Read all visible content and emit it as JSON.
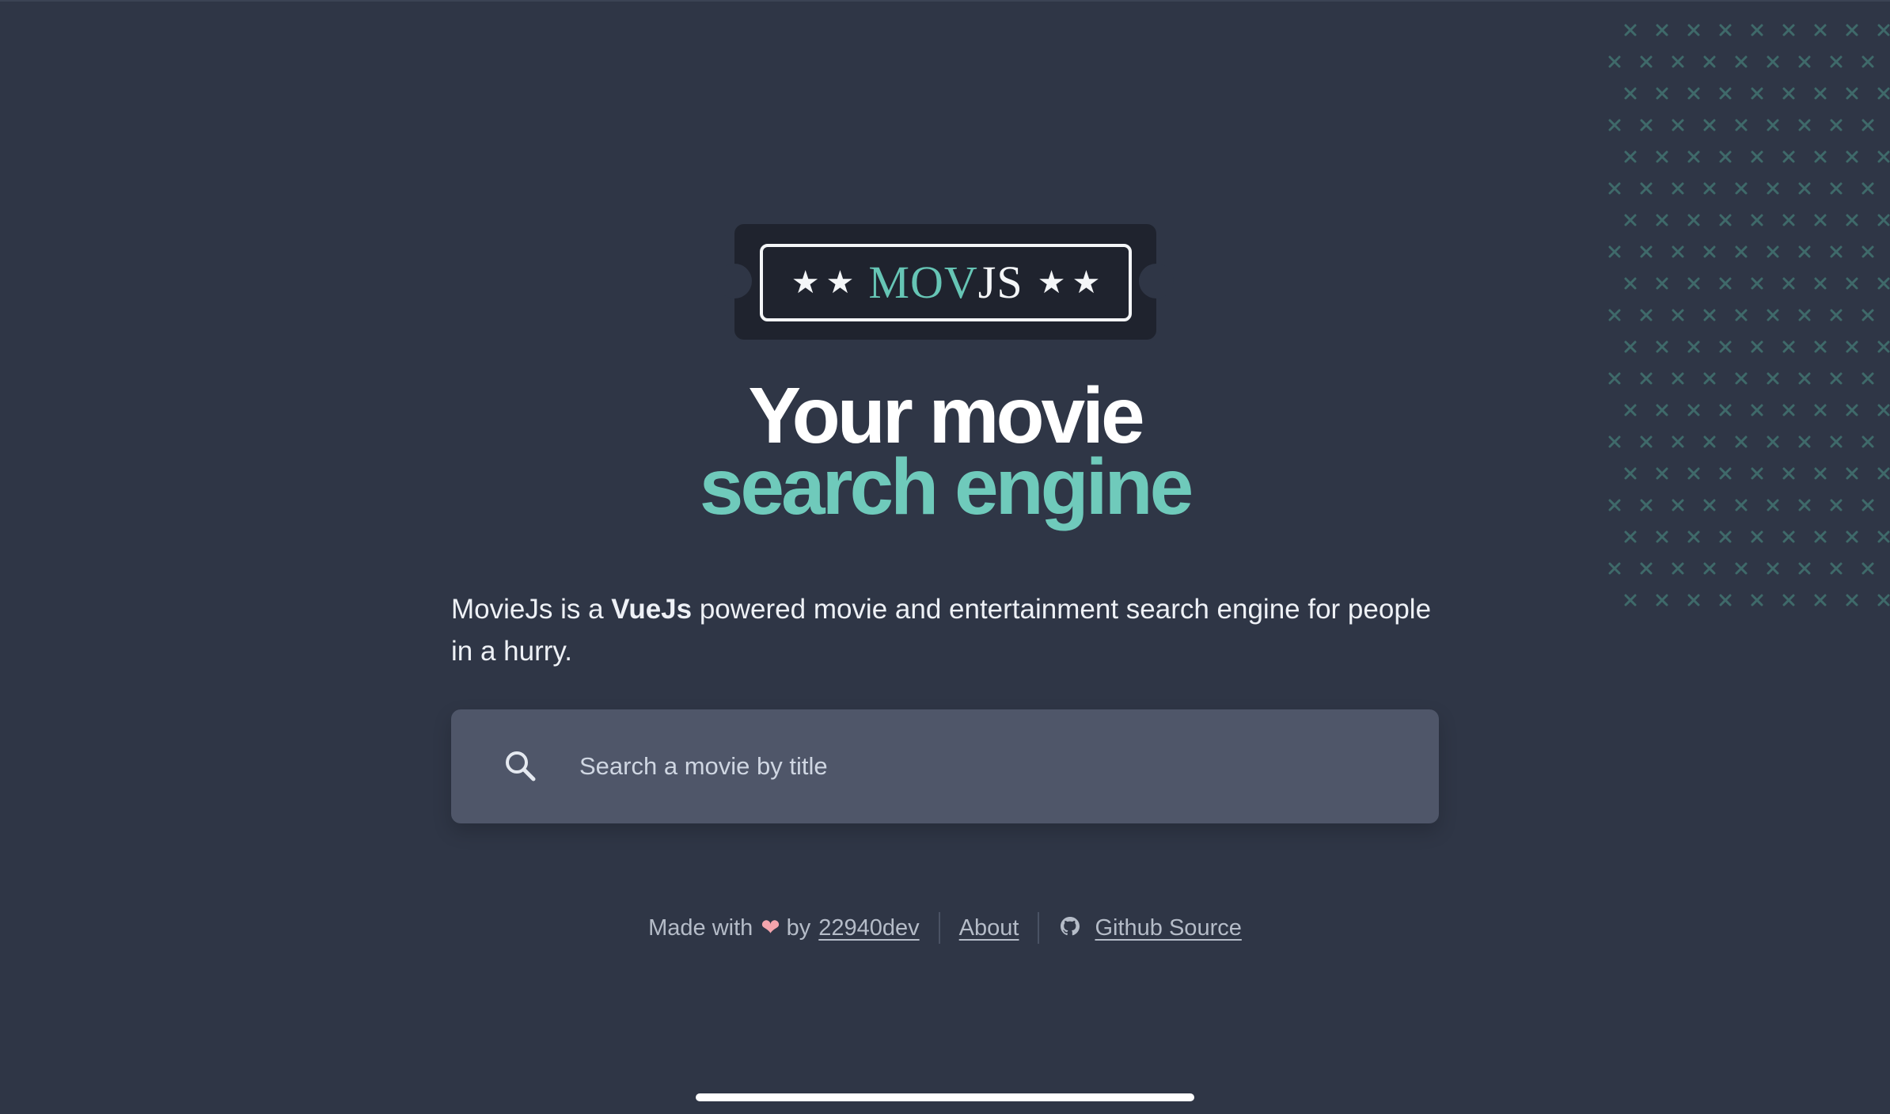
{
  "colors": {
    "background": "#2f3646",
    "accent": "#6fcabb",
    "logo_background": "#1f232e",
    "search_background": "#4f5669",
    "heart": "#f3a5ad"
  },
  "logo": {
    "mov_text": "MOV",
    "js_text": "JS",
    "star": "★"
  },
  "hero": {
    "headline_line1": "Your movie",
    "headline_line2": "search engine",
    "description_before": "MovieJs is a ",
    "description_bold": "VueJs",
    "description_after": " powered movie and entertainment search engine for people in a hurry."
  },
  "search": {
    "icon": "search-icon",
    "placeholder": "Search a movie by title",
    "value": ""
  },
  "footer": {
    "made_with": "Made with",
    "heart": "❤",
    "by": "by",
    "author_link": "22940dev",
    "about_link": "About",
    "github_icon": "github-icon",
    "github_link": "Github Source"
  }
}
